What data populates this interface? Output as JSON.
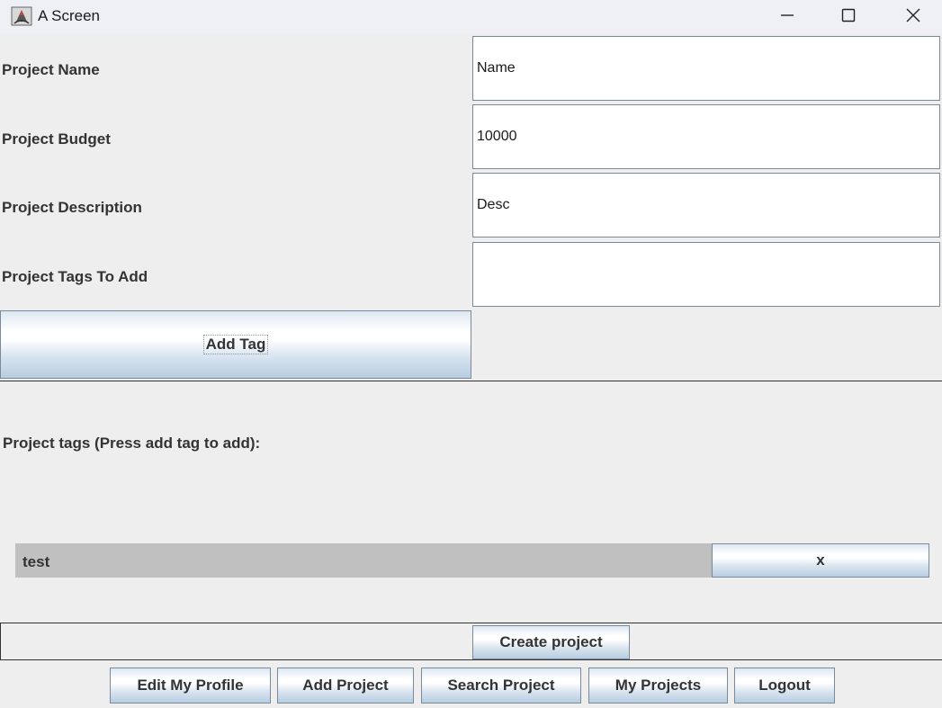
{
  "window": {
    "title": "A Screen",
    "icons": [
      "java-app-icon",
      "minimize-icon",
      "maximize-icon",
      "close-icon"
    ]
  },
  "form": {
    "name_label": "Project Name",
    "name_value": "Name",
    "budget_label": "Project Budget",
    "budget_value": "10000",
    "description_label": "Project Description",
    "description_value": "Desc",
    "tags_label": "Project Tags To Add",
    "tags_value": "",
    "add_tag_button": "Add Tag"
  },
  "tags": {
    "heading": "Project tags (Press add tag to add):",
    "items": [
      {
        "name": "test",
        "remove_label": "x"
      }
    ]
  },
  "create_button": "Create project",
  "nav": {
    "edit_profile": "Edit My Profile",
    "add_project": "Add Project",
    "search_project": "Search Project",
    "my_projects": "My Projects",
    "logout": "Logout"
  }
}
